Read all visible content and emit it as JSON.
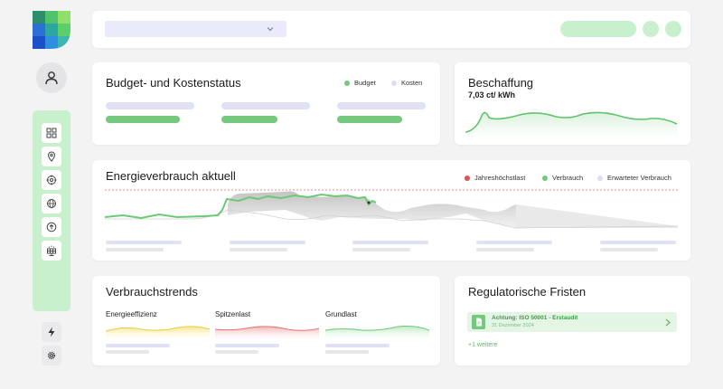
{
  "app": {
    "logo_icon": "leaf-logo-icon"
  },
  "colors": {
    "accent_green": "#76c97c",
    "lavender": "#e1e1f6",
    "peak_red": "#d9534f"
  },
  "sidebar": {
    "items": [
      {
        "name": "dashboard-icon"
      },
      {
        "name": "location-icon"
      },
      {
        "name": "target-icon"
      },
      {
        "name": "globe-icon"
      },
      {
        "name": "upload-icon"
      },
      {
        "name": "solar-panel-icon"
      }
    ],
    "bottom": [
      {
        "name": "lightning-icon"
      },
      {
        "name": "settings-icon"
      }
    ]
  },
  "budget": {
    "title": "Budget- und Kostenstatus",
    "legend": [
      {
        "label": "Budget",
        "color": "#76c97c"
      },
      {
        "label": "Kosten",
        "color": "#dcdcf4"
      }
    ]
  },
  "procurement": {
    "title": "Beschaffung",
    "value": "7,03 ct/ kWh"
  },
  "energy": {
    "title": "Energieverbrauch aktuell",
    "legend": [
      {
        "label": "Jahreshöchstlast",
        "color": "#d9534f"
      },
      {
        "label": "Verbrauch",
        "color": "#76c97c"
      },
      {
        "label": "Erwarteter Verbrauch",
        "color": "#dcdcf4"
      }
    ]
  },
  "trends": {
    "title": "Verbrauchstrends",
    "items": [
      {
        "label": "Energieeffizienz",
        "color": "#f2dc6a"
      },
      {
        "label": "Spitzenlast",
        "color": "#e88a87"
      },
      {
        "label": "Grundlast",
        "color": "#76c97c"
      }
    ]
  },
  "deadlines": {
    "title": "Regulatorische Fristen",
    "item": {
      "title": "Achtung: ISO 50001 - Erstaudit",
      "date": "31 Dezember 2024"
    },
    "more": "+1 weitere"
  }
}
